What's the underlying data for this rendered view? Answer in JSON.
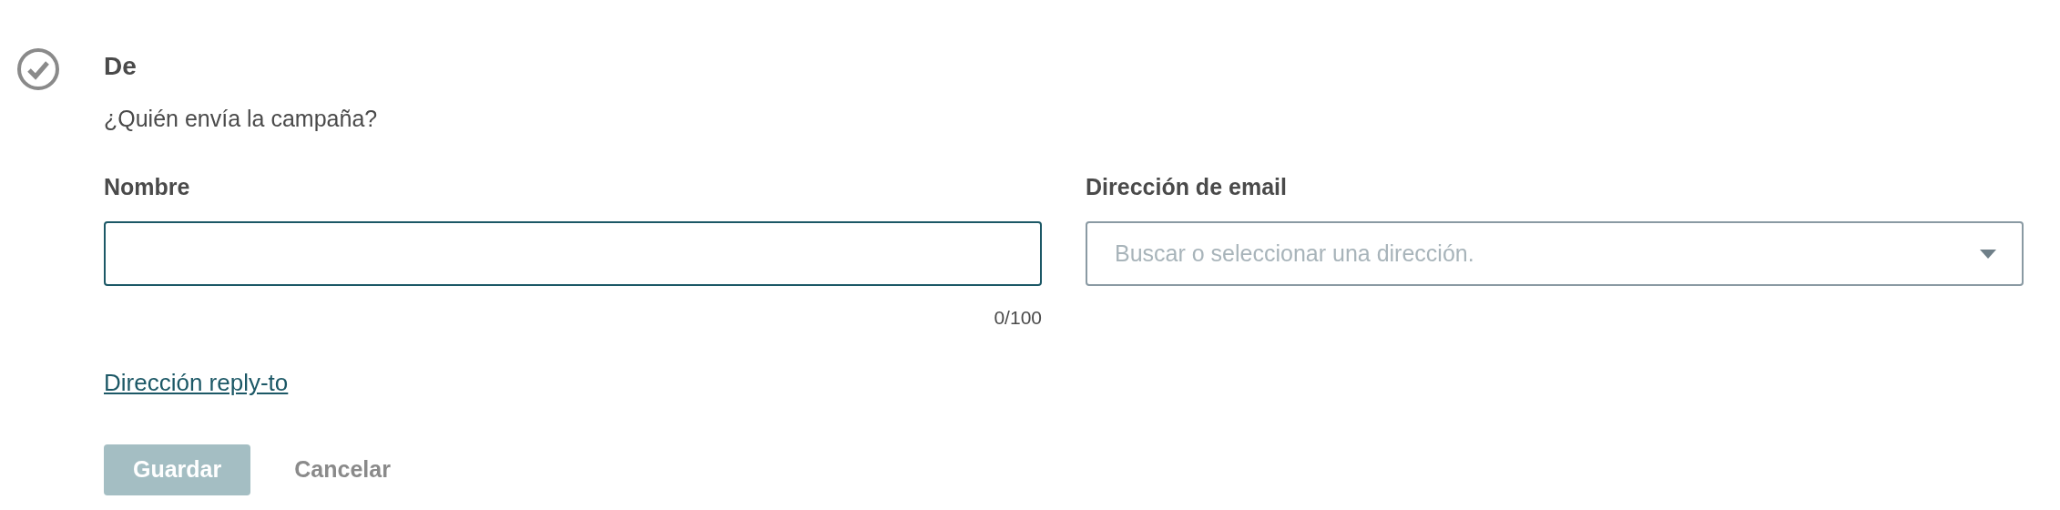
{
  "section": {
    "title": "De",
    "completed": true,
    "subtitle": "¿Quién envía la campaña?"
  },
  "name_field": {
    "label": "Nombre",
    "counter": "0/100",
    "focused": true
  },
  "email_field": {
    "label": "Dirección de email",
    "placeholder": "Buscar o seleccionar una dirección."
  },
  "reply_to_link": "Dirección reply-to",
  "buttons": [
    {
      "kind": "primary",
      "label": "Guardar",
      "disabled": true
    },
    {
      "kind": "text",
      "label": "Cancelar",
      "disabled": false
    }
  ]
}
